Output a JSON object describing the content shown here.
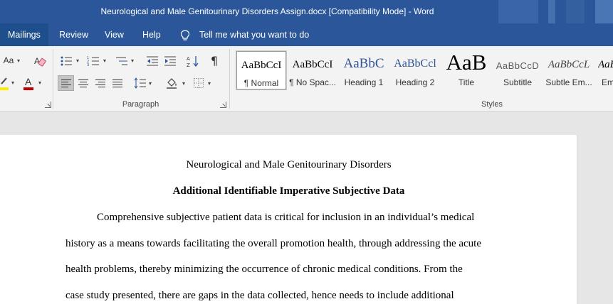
{
  "window": {
    "title": "Neurological and Male Genitourinary Disorders Assign.docx [Compatibility Mode]  -  Word"
  },
  "ribbon_tabs": [
    {
      "label": "Mailings",
      "active": true
    },
    {
      "label": "Review",
      "active": false
    },
    {
      "label": "View",
      "active": false
    },
    {
      "label": "Help",
      "active": false
    }
  ],
  "tell_me": {
    "label": "Tell me what you want to do",
    "icon": "lightbulb-icon"
  },
  "font_group": {
    "change_case": "Aa",
    "icons": [
      "change-case-icon",
      "clear-formatting-icon",
      "highlight-icon",
      "font-color-icon"
    ],
    "highlight_color": "#ffeb00",
    "font_color": "#c00000"
  },
  "paragraph_group": {
    "label": "Paragraph",
    "icons": [
      "bullets-icon",
      "numbering-icon",
      "multilevel-list-icon",
      "decrease-indent-icon",
      "increase-indent-icon",
      "sort-icon",
      "show-marks-icon",
      "align-left-icon",
      "center-icon",
      "align-right-icon",
      "justify-icon",
      "line-spacing-icon",
      "shading-icon",
      "borders-icon"
    ],
    "pilcrow": "¶"
  },
  "styles_group": {
    "label": "Styles",
    "items": [
      {
        "sample": "AaBbCcI",
        "name": "¶ Normal",
        "selected": true
      },
      {
        "sample": "AaBbCcI",
        "name": "¶ No Spac...",
        "selected": false
      },
      {
        "sample": "AaBbC",
        "name": "Heading 1",
        "selected": false
      },
      {
        "sample": "AaBbCcl",
        "name": "Heading 2",
        "selected": false
      },
      {
        "sample": "AaB",
        "name": "Title",
        "selected": false
      },
      {
        "sample": "AaBbCcD",
        "name": "Subtitle",
        "selected": false
      },
      {
        "sample": "AaBbCcL",
        "name": "Subtle Em...",
        "selected": false
      },
      {
        "sample": "AaBl",
        "name": "Em",
        "selected": false
      }
    ],
    "heading_color": "#2f5496"
  },
  "document": {
    "title": "Neurological and Male Genitourinary Disorders",
    "heading": "Additional Identifiable Imperative Subjective Data",
    "lines": [
      "Comprehensive subjective patient data is critical for inclusion in an individual’s medical",
      "history as a means towards facilitating the overall promotion health, through addressing the acute",
      "health problems, thereby minimizing the occurrence of chronic medical conditions. From the",
      "case study presented, there are gaps in the data collected, hence needs to include additional"
    ]
  },
  "colors": {
    "word_blue": "#2b579a",
    "ribbon_bg": "#f3f3f3",
    "canvas_bg": "#e6e6e6"
  }
}
